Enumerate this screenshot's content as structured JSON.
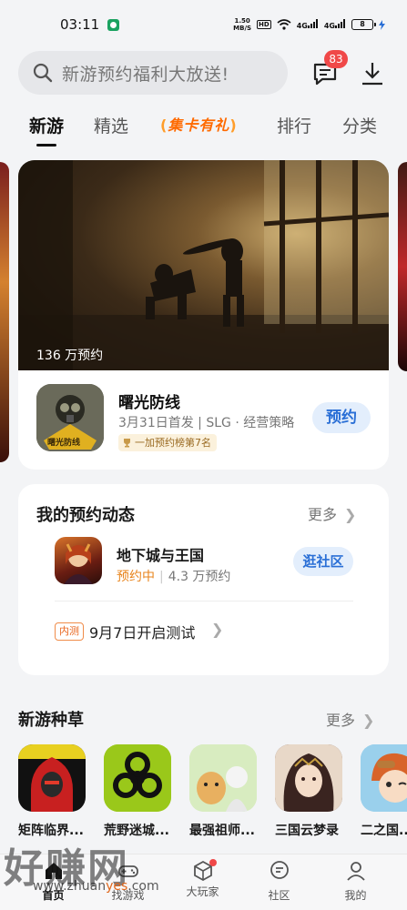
{
  "status_bar": {
    "time": "03:11",
    "net_speed_value": "1.50",
    "net_speed_unit": "MB/S",
    "hd": "HD",
    "signal1": "4G",
    "signal2": "4G",
    "battery": "8"
  },
  "header": {
    "search_placeholder": "新游预约福利大放送!",
    "message_badge": "83"
  },
  "tabs": {
    "items": [
      "新游",
      "精选",
      "排行",
      "分类"
    ],
    "promo": "集卡有礼",
    "active": "新游"
  },
  "hero": {
    "reservation_count": "136 万预约",
    "game_title": "曙光防线",
    "meta": "3月31日首发 | SLG · 经营策略",
    "rank": "一加预约榜第7名",
    "reserve_label": "预约",
    "icon_text": "曙光防线"
  },
  "my_reservations": {
    "title": "我的预约动态",
    "more": "更多",
    "game_name": "地下城与王国",
    "status": "预约中",
    "count": "4.3 万预约",
    "community_label": "逛社区",
    "test_tag": "内测",
    "test_text": "9月7日开启测试"
  },
  "new_games": {
    "title": "新游种草",
    "more": "更多",
    "items": [
      {
        "name": "矩阵临界...",
        "icon": "red-hood-icon",
        "color": "#e23a2a"
      },
      {
        "name": "荒野迷城...",
        "icon": "biohazard-icon",
        "color": "#a8d020"
      },
      {
        "name": "最强祖师...",
        "icon": "cartoon-cat-icon",
        "color": "#8fc86a"
      },
      {
        "name": "三国云梦录",
        "icon": "anime-girl-icon",
        "color": "#5a3a3a"
      },
      {
        "name": "二之国...",
        "icon": "anime-boy-icon",
        "color": "#d86a2a"
      }
    ]
  },
  "bottom_nav": {
    "items": [
      "首页",
      "找游戏",
      "大玩家",
      "社区",
      "我的"
    ],
    "active": "首页"
  },
  "watermark": {
    "main": "好赚网",
    "url_a": "www.zhuan",
    "url_b": "yes",
    "url_c": ".com"
  }
}
